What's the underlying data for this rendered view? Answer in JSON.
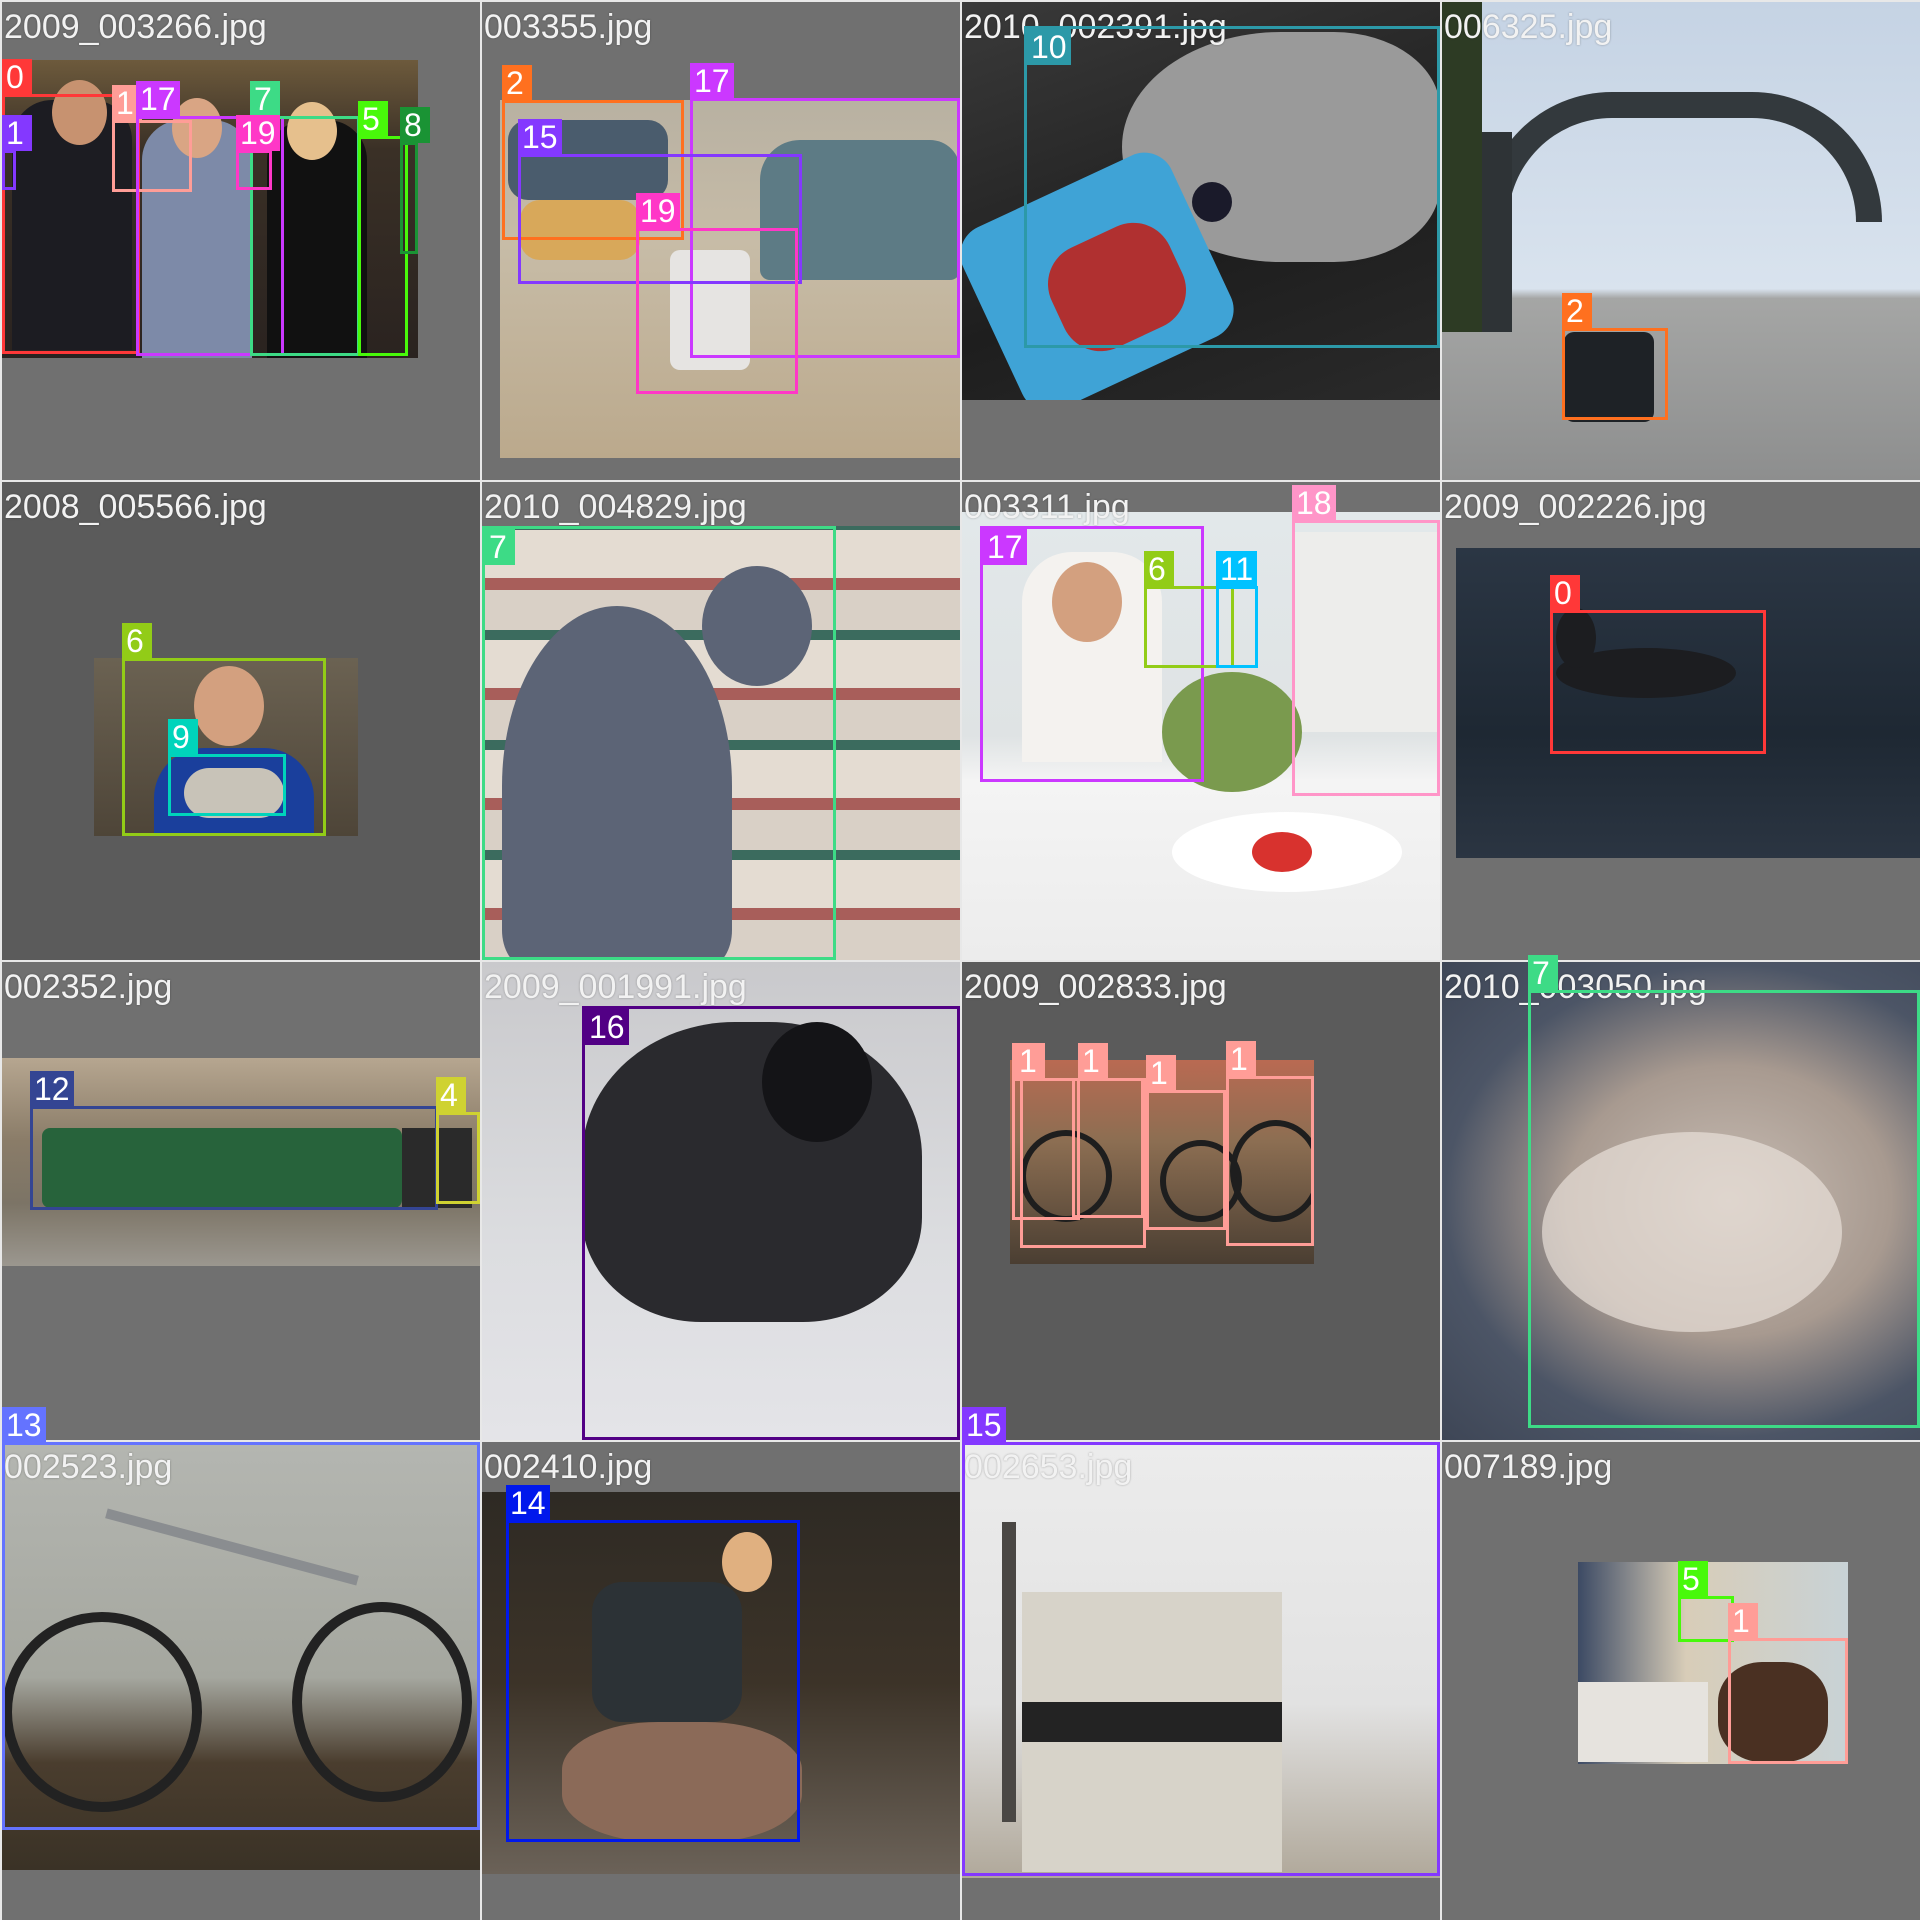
{
  "tiles": [
    {
      "filename": "2009_003266.jpg",
      "bg": "#707070"
    },
    {
      "filename": "003355.jpg",
      "bg": "#707070"
    },
    {
      "filename": "2010_002391.jpg",
      "bg": "#707070"
    },
    {
      "filename": "006325.jpg",
      "bg": "#707070"
    },
    {
      "filename": "2008_005566.jpg",
      "bg": "#5b5b5b"
    },
    {
      "filename": "2010_004829.jpg",
      "bg": "#707070"
    },
    {
      "filename": "003311.jpg",
      "bg": "#707070"
    },
    {
      "filename": "2009_002226.jpg",
      "bg": "#707070"
    },
    {
      "filename": "002352.jpg",
      "bg": "#707070"
    },
    {
      "filename": "2009_001991.jpg",
      "bg": "#5b5b5b"
    },
    {
      "filename": "2009_002833.jpg",
      "bg": "#5b5b5b"
    },
    {
      "filename": "2010_003050.jpg",
      "bg": "#707070"
    },
    {
      "filename": "002523.jpg",
      "bg": "#707070"
    },
    {
      "filename": "002410.jpg",
      "bg": "#707070"
    },
    {
      "filename": "002653.jpg",
      "bg": "#707070"
    },
    {
      "filename": "007189.jpg",
      "bg": "#707070"
    }
  ],
  "class_colors": {
    "0": "#ff3838",
    "1": "#ff9d97",
    "2": "#ff701f",
    "4": "#cfd231",
    "5": "#48f90a",
    "6": "#92cc17",
    "7": "#3ddb86",
    "8": "#1a9334",
    "9": "#00d4bb",
    "10": "#2c99a8",
    "11": "#00c2ff",
    "12": "#344593",
    "13": "#6473ff",
    "14": "#0018ec",
    "15": "#8438ff",
    "16": "#520085",
    "17": "#cb38ff",
    "18": "#ff95c8",
    "19": "#ff37c7"
  },
  "labels": {
    "t0": [
      "0",
      "1",
      "17",
      "7",
      "19",
      "1",
      "5",
      "8"
    ],
    "t1": [
      "2",
      "17",
      "15",
      "19"
    ],
    "t2": [
      "10"
    ],
    "t3": [
      "2"
    ],
    "t4": [
      "6",
      "9"
    ],
    "t5": [
      "7"
    ],
    "t6": [
      "17",
      "6",
      "11",
      "18"
    ],
    "t7": [
      "0"
    ],
    "t8": [
      "12",
      "4"
    ],
    "t9": [
      "16"
    ],
    "t10": [
      "1",
      "1",
      "1",
      "1",
      "1"
    ],
    "t11": [
      "7"
    ],
    "t12": [
      "13"
    ],
    "t13": [
      "14"
    ],
    "t14": [
      "15"
    ],
    "t15": [
      "5",
      "1"
    ]
  }
}
